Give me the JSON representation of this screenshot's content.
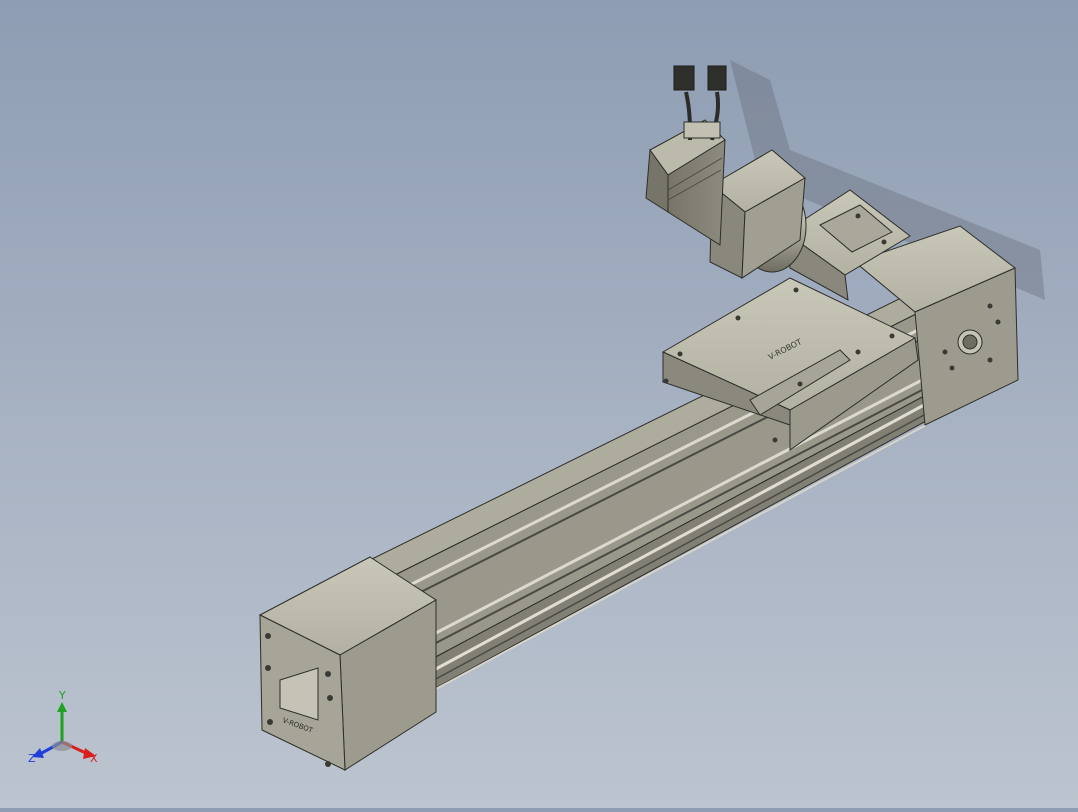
{
  "viewport": {
    "model": {
      "brand_marking": "V-ROBOT"
    }
  },
  "triad": {
    "x_label": "X",
    "y_label": "Y",
    "z_label": "Z",
    "colors": {
      "x": "#d81e1e",
      "y": "#1fa21f",
      "z": "#1f3fd8"
    }
  }
}
